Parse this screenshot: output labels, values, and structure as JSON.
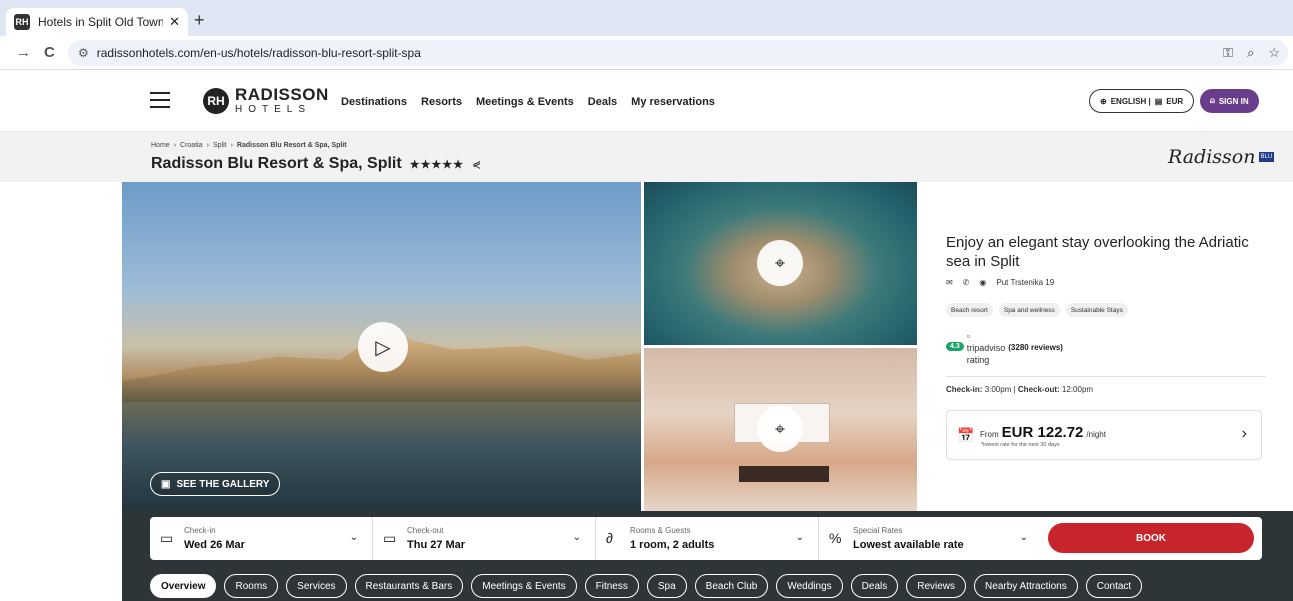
{
  "browser": {
    "tab_title": "Hotels in Split Old Town | Radis",
    "tab_favicon": "RH",
    "tab_close": "✕",
    "new_tab": "+",
    "back_icon": "→",
    "reload_icon": "C",
    "url": "radissonhotels.com/en-us/hotels/radisson-blu-resort-split-spa"
  },
  "header": {
    "logo_mark": "RH",
    "logo_word1": "RADISSON",
    "logo_word2": "HOTELS",
    "nav": [
      "Destinations",
      "Resorts",
      "Meetings & Events",
      "Deals",
      "My reservations"
    ],
    "language": "ENGLISH | ",
    "currency": "EUR",
    "signin": "SIGN IN",
    "accent": "#6a3c8c"
  },
  "hotel": {
    "breadcrumbs": [
      "Home",
      "Croatia",
      "Split",
      "Radisson Blu Resort & Spa, Split"
    ],
    "crumb_sep": "›",
    "name": "Radisson Blu Resort & Spa, Split",
    "stars": "★★★★★",
    "brand_script": "Radisson",
    "brand_badge": "BLU"
  },
  "gallery": {
    "see_gallery": "SEE THE GALLERY"
  },
  "info": {
    "tagline": "Enjoy an elegant stay overlooking the Adriatic sea in Split",
    "address": "Put Trstenika 19",
    "chips": [
      "Beach resort",
      "Spa and wellness",
      "Sustainable Stays"
    ],
    "score": "4.3",
    "rating_img_alt": "tripadvisor rating",
    "reviews": "(3280 reviews)",
    "checkin_label": "Check-in:",
    "checkin_time": "3:00pm",
    "checkout_label": "Check-out:",
    "checkout_time": "12:00pm",
    "price_from": "From",
    "price": "EUR 122.72",
    "per_night": "/night",
    "price_note": "*lowest rate for the next 30 days"
  },
  "booking": {
    "checkin_label": "Check-in",
    "checkin_value": "Wed 26 Mar",
    "checkout_label": "Check-out",
    "checkout_value": "Thu 27 Mar",
    "rooms_label": "Rooms & Guests",
    "rooms_value": "1 room, 2 adults",
    "rates_label": "Special Rates",
    "rates_value": "Lowest available rate",
    "book": "BOOK",
    "book_color": "#c7252b"
  },
  "subnav": [
    "Overview",
    "Rooms",
    "Services",
    "Restaurants & Bars",
    "Meetings & Events",
    "Fitness",
    "Spa",
    "Beach Club",
    "Weddings",
    "Deals",
    "Reviews",
    "Nearby Attractions",
    "Contact"
  ]
}
